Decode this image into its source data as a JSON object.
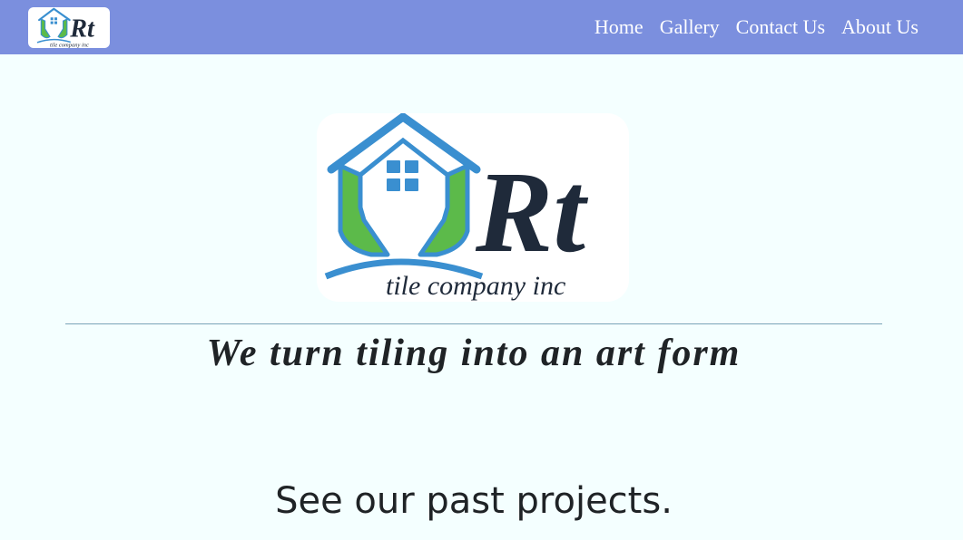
{
  "brand": {
    "logo_initials": "Rt",
    "logo_subtitle": "tile company inc",
    "colors": {
      "house": "#3a8fd0",
      "hands": "#5cba4a",
      "text": "#1f2a3a"
    }
  },
  "nav": {
    "background": "#7b8fde",
    "items": [
      {
        "label": "Home"
      },
      {
        "label": "Gallery"
      },
      {
        "label": "Contact Us"
      },
      {
        "label": "About Us"
      }
    ]
  },
  "hero": {
    "tagline": "We turn tiling into an art form"
  },
  "projects": {
    "heading": "See our past projects."
  }
}
